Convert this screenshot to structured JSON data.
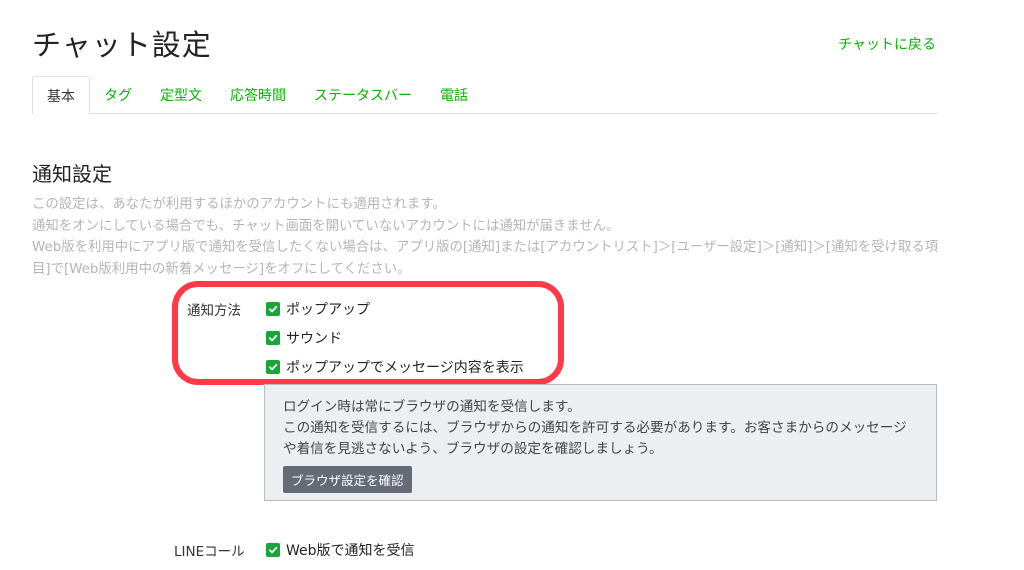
{
  "header": {
    "title": "チャット設定",
    "back_link": "チャットに戻る"
  },
  "tabs": [
    {
      "label": "基本",
      "active": true
    },
    {
      "label": "タグ"
    },
    {
      "label": "定型文"
    },
    {
      "label": "応答時間"
    },
    {
      "label": "ステータスバー"
    },
    {
      "label": "電話"
    }
  ],
  "notification": {
    "title": "通知設定",
    "description": [
      "この設定は、あなたが利用するほかのアカウントにも適用されます。",
      "通知をオンにしている場合でも、チャット画面を開いていないアカウントには通知が届きません。",
      "Web版を利用中にアプリ版で通知を受信したくない場合は、アプリ版の[通知]または[アカウントリスト]＞[ユーザー設定]＞[通知]＞[通知を受け取る項目]で[Web版利用中の新着メッセージ]をオフにしてください。"
    ],
    "method_label": "通知方法",
    "options": [
      {
        "label": "ポップアップ",
        "checked": true
      },
      {
        "label": "サウンド",
        "checked": true
      },
      {
        "label": "ポップアップでメッセージ内容を表示",
        "checked": true
      }
    ],
    "info": {
      "line1": "ログイン時は常にブラウザの通知を受信します。",
      "line2": "この通知を受信するには、ブラウザからの通知を許可する必要があります。お客さまからのメッセージや着信を見逃さないよう、ブラウザの設定を確認しましょう。",
      "button": "ブラウザ設定を確認"
    }
  },
  "line_call": {
    "label": "LINEコール",
    "option": {
      "label": "Web版で通知を受信",
      "checked": true
    }
  },
  "colors": {
    "accent_green": "#06b300",
    "checkbox_green": "#1aa53a",
    "highlight_red": "#ff3a46"
  }
}
